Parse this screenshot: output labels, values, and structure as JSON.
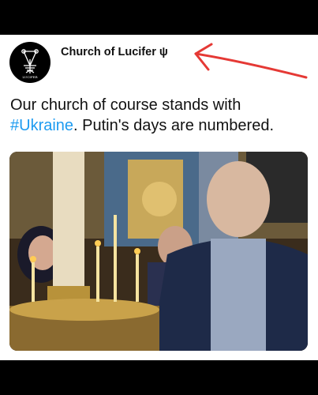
{
  "post": {
    "account_name": "Church of Lucifer ψ",
    "avatar": {
      "icon": "sigil-icon",
      "label": "LUCIFER"
    },
    "text_before": "Our church of course stands with ",
    "hashtag": "#Ukraine",
    "text_after": ". Putin's days are numbered.",
    "image": {
      "icon": "photo-church-candles"
    }
  },
  "colors": {
    "hashtag": "#1d9bf0",
    "annotation_arrow": "#e53935",
    "background": "#ffffff",
    "bars": "#000000"
  }
}
